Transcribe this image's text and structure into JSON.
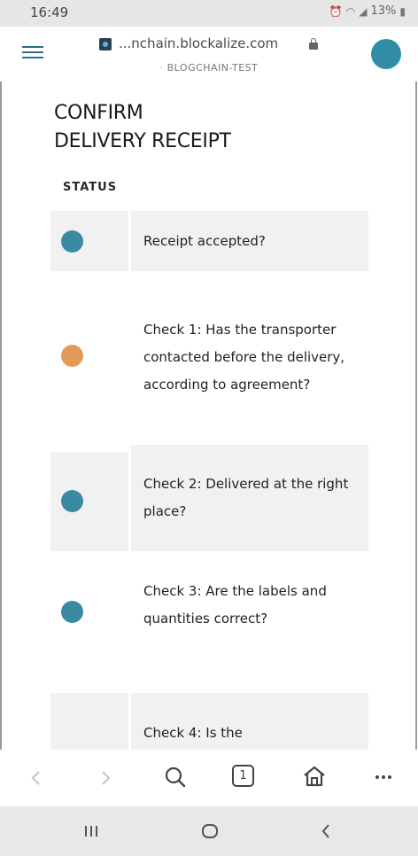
{
  "status_bar": {
    "time": "16:49",
    "battery": "13%"
  },
  "browser": {
    "url": "...nchain.blockalize.com",
    "subtitle": "BLOGCHAIN-TEST",
    "icons": [
      "menu-icon",
      "favicon",
      "lock-icon",
      "profile-avatar"
    ],
    "avatar_color": "#2f8ea5"
  },
  "page": {
    "title_line1": "CONFIRM",
    "title_line2": "DELIVERY RECEIPT",
    "status_label": "STATUS"
  },
  "checklist": [
    {
      "text": "Receipt accepted?",
      "status_color": "#3a8aa3",
      "shaded": true
    },
    {
      "text": "Check 1: Has the transporter contacted before the delivery, according to agreement?",
      "status_color": "#e19a5a",
      "shaded": false
    },
    {
      "text": "Check 2: Delivered at the right place?",
      "status_color": "#3a8aa3",
      "shaded": true
    },
    {
      "text": "Check 3: Are the labels and quantities correct?",
      "status_color": "#3a8aa3",
      "shaded": false
    },
    {
      "text": "Check 4: Is the",
      "status_color": null,
      "shaded": true
    }
  ],
  "browser_nav": {
    "tab_count": "1",
    "icons": [
      "back-icon",
      "forward-icon",
      "search-icon",
      "tabs-icon",
      "home-icon",
      "more-icon"
    ]
  },
  "system_nav": {
    "icons": [
      "recent-apps-icon",
      "home-circle-icon",
      "system-back-icon"
    ]
  },
  "colors": {
    "accent": "#3a8aa3",
    "warning": "#e19a5a",
    "row_shade": "#f1f1f1"
  }
}
